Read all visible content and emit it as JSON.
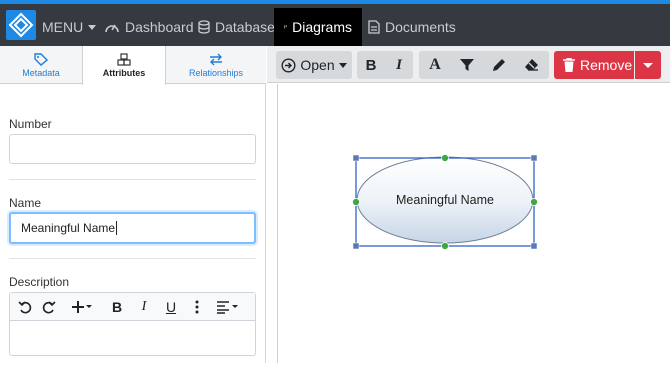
{
  "nav": {
    "menu_label": "MENU",
    "items": [
      {
        "label": "Dashboard"
      },
      {
        "label": "Database"
      },
      {
        "label": "Diagrams"
      },
      {
        "label": "Documents"
      }
    ]
  },
  "panel": {
    "tabs": [
      {
        "label": "Metadata"
      },
      {
        "label": "Attributes"
      },
      {
        "label": "Relationships"
      }
    ],
    "fields": {
      "number": {
        "label": "Number",
        "value": ""
      },
      "name": {
        "label": "Name",
        "value": "Meaningful Name"
      },
      "description": {
        "label": "Description",
        "value": ""
      }
    }
  },
  "toolbar": {
    "open_label": "Open",
    "bold": "B",
    "italic": "I",
    "font": "A",
    "remove_label": "Remove"
  },
  "editor": {
    "bold": "B",
    "italic": "I",
    "underline": "U"
  },
  "diagram": {
    "shape_label": "Meaningful Name"
  },
  "colors": {
    "accent": "#1e88e5",
    "remove": "#dc3545",
    "topbar": "#343a40"
  }
}
